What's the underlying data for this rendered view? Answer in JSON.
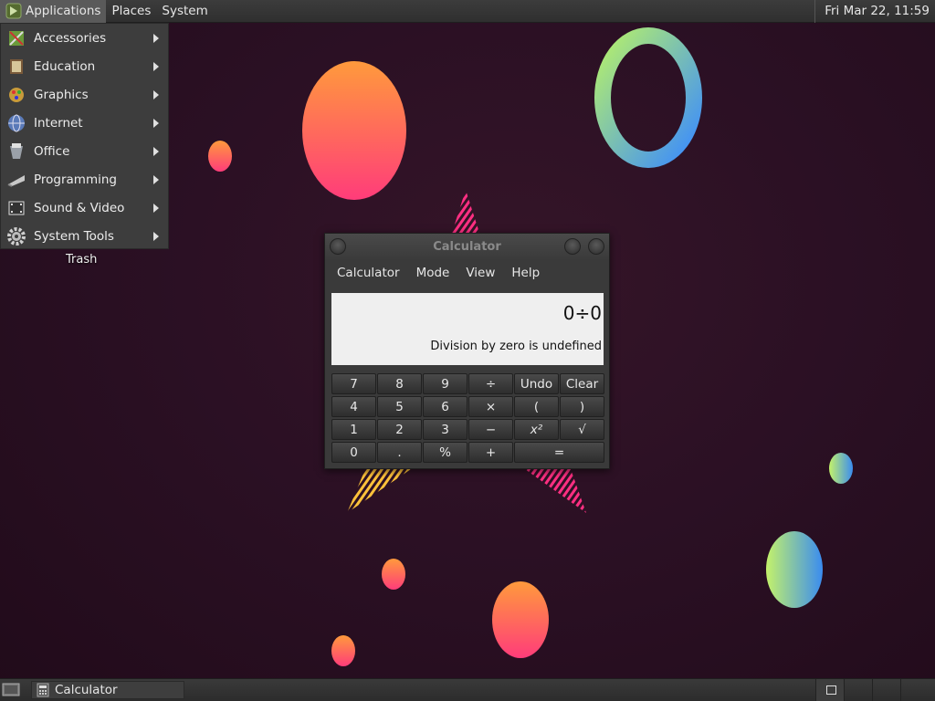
{
  "top_panel": {
    "menus": [
      {
        "label": "Applications",
        "icon": "distro-logo-icon"
      },
      {
        "label": "Places"
      },
      {
        "label": "System"
      }
    ],
    "clock": "Fri Mar 22, 11:59"
  },
  "apps_menu": {
    "items": [
      {
        "label": "Accessories",
        "icon": "accessories-icon"
      },
      {
        "label": "Education",
        "icon": "education-icon"
      },
      {
        "label": "Graphics",
        "icon": "graphics-icon"
      },
      {
        "label": "Internet",
        "icon": "globe-icon"
      },
      {
        "label": "Office",
        "icon": "office-icon"
      },
      {
        "label": "Programming",
        "icon": "programming-icon"
      },
      {
        "label": "Sound & Video",
        "icon": "multimedia-icon"
      },
      {
        "label": "System Tools",
        "icon": "gear-icon"
      }
    ]
  },
  "desktop": {
    "icons": [
      {
        "label": "Trash",
        "icon": "trash-icon"
      }
    ]
  },
  "calculator": {
    "title": "Calculator",
    "menu": [
      "Calculator",
      "Mode",
      "View",
      "Help"
    ],
    "display": {
      "expression": "0÷0",
      "message": "Division by zero is undefined"
    },
    "keys": {
      "k7": "7",
      "k8": "8",
      "k9": "9",
      "divide": "÷",
      "undo": "Undo",
      "clear": "Clear",
      "k4": "4",
      "k5": "5",
      "k6": "6",
      "multiply": "×",
      "lparen": "(",
      "rparen": ")",
      "k1": "1",
      "k2": "2",
      "k3": "3",
      "minus": "−",
      "square": "x²",
      "sqrt": "√",
      "k0": "0",
      "point": ".",
      "percent": "%",
      "plus": "+",
      "equals": "="
    }
  },
  "taskbar": {
    "tasks": [
      {
        "label": "Calculator",
        "icon": "calculator-icon"
      }
    ],
    "workspace_count": 4
  },
  "colors": {
    "panel": "#333333",
    "desktop_bg": "#2b1024",
    "menu_bg": "#3d3d3d",
    "display_bg": "#efefef"
  }
}
